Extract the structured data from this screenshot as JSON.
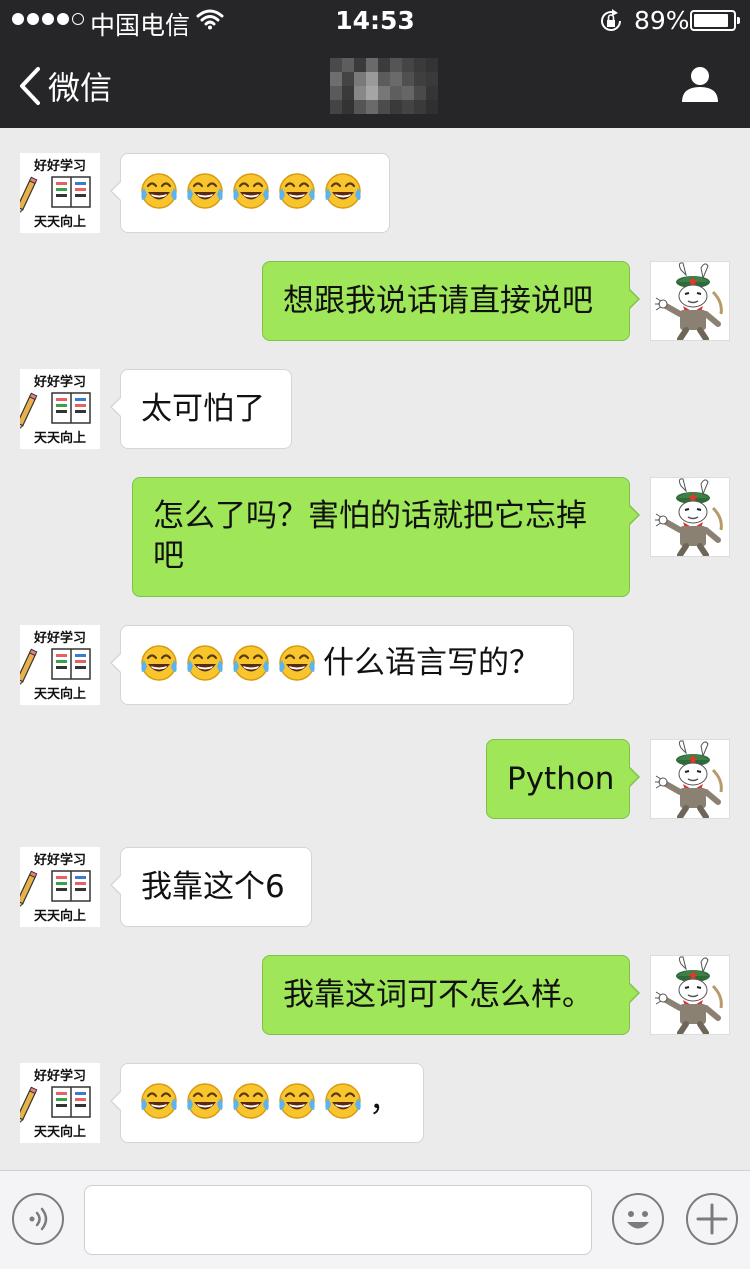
{
  "status_bar": {
    "carrier": "中国电信",
    "time": "14:53",
    "battery_percent": "89%",
    "battery_level": 0.89,
    "signal_bars_filled": 4,
    "signal_bars_total": 5
  },
  "nav": {
    "back_label": "微信"
  },
  "avatars": {
    "contact": {
      "top_text": "好好学习",
      "bottom_text": "天天向上"
    }
  },
  "messages": [
    {
      "side": "left",
      "text": "",
      "emoji": [
        "joy-emoji",
        "joy-emoji",
        "joy-emoji",
        "joy-emoji",
        "joy-emoji"
      ]
    },
    {
      "side": "right",
      "text": "想跟我说话请直接说吧"
    },
    {
      "side": "left",
      "text": "太可怕了"
    },
    {
      "side": "right",
      "line1": "怎么了吗？害怕的话就把它忘掉",
      "line2": "吧"
    },
    {
      "side": "left",
      "text": "什么语言写的？",
      "emoji": [
        "joy-emoji",
        "joy-emoji",
        "joy-emoji",
        "joy-emoji"
      ]
    },
    {
      "side": "right",
      "text": "Python"
    },
    {
      "side": "left",
      "text": "我靠这个6"
    },
    {
      "side": "right",
      "text": "我靠这词可不怎么样。"
    },
    {
      "side": "left",
      "text": "，",
      "emoji": [
        "joy-emoji",
        "joy-emoji",
        "joy-emoji",
        "joy-emoji",
        "joy-emoji"
      ]
    }
  ],
  "colors": {
    "top_bar": "#262628",
    "chat_background": "#ebebeb",
    "outgoing_bubble": "#9fe658",
    "incoming_bubble": "#ffffff"
  }
}
